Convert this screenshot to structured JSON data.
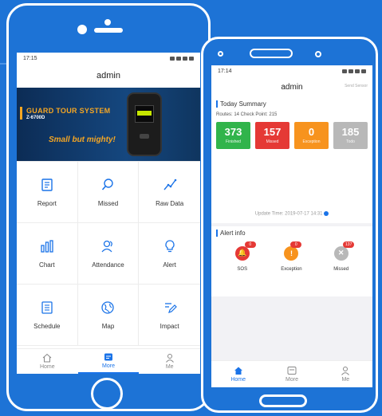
{
  "left_phone": {
    "status": {
      "time": "17:15"
    },
    "title": "admin",
    "banner": {
      "title": "GUARD TOUR SYSTEM",
      "model": "Z-6700D",
      "slogan": "Small but mighty!"
    },
    "grid": [
      {
        "label": "Report",
        "icon": "report-icon"
      },
      {
        "label": "Missed",
        "icon": "search-icon"
      },
      {
        "label": "Raw Data",
        "icon": "line-chart-icon"
      },
      {
        "label": "Chart",
        "icon": "bar-chart-icon"
      },
      {
        "label": "Attendance",
        "icon": "people-icon"
      },
      {
        "label": "Alert",
        "icon": "lightbulb-icon"
      },
      {
        "label": "Schedule",
        "icon": "list-icon"
      },
      {
        "label": "Map",
        "icon": "globe-icon"
      },
      {
        "label": "Impact",
        "icon": "edit-icon"
      }
    ],
    "tabs": [
      {
        "label": "Home",
        "icon": "home-icon"
      },
      {
        "label": "More",
        "icon": "more-icon",
        "active": true
      },
      {
        "label": "Me",
        "icon": "person-icon"
      }
    ]
  },
  "right_phone": {
    "status": {
      "time": "17:14"
    },
    "title": "admin",
    "settings_link": "Send Sensor",
    "summary": {
      "title": "Today Summary",
      "routes": "Routes: 14   Check Point: 215",
      "cards": [
        {
          "value": "373",
          "label": "Finished",
          "color": "#31b44b"
        },
        {
          "value": "157",
          "label": "Missed",
          "color": "#e53935"
        },
        {
          "value": "0",
          "label": "Exception",
          "color": "#f7931e"
        },
        {
          "value": "185",
          "label": "Todo",
          "color": "#b8b8b8"
        }
      ],
      "update": "Update Time: 2019-07-17 14:31"
    },
    "alerts": {
      "title": "Alert info",
      "items": [
        {
          "label": "SOS",
          "count": "0",
          "color": "#e53935",
          "icon": "sos-icon"
        },
        {
          "label": "Exception",
          "count": "0",
          "color": "#f7931e",
          "icon": "exclamation-icon"
        },
        {
          "label": "Missed",
          "count": "137",
          "color": "#b8b8b8",
          "icon": "x-icon"
        }
      ]
    },
    "tabs": [
      {
        "label": "Home",
        "icon": "home-icon",
        "active": true
      },
      {
        "label": "More",
        "icon": "more-icon"
      },
      {
        "label": "Me",
        "icon": "person-icon"
      }
    ]
  }
}
